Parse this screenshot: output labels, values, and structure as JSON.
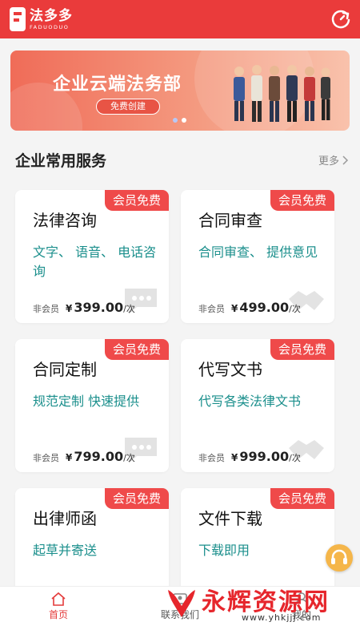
{
  "app": {
    "logo_cn": "法多多",
    "logo_en": "FADUODUO"
  },
  "banner": {
    "title": "企业云端法务部",
    "button": "免费创建",
    "slides": 2,
    "active_slide": 0
  },
  "section": {
    "title": "企业常用服务",
    "more": "更多"
  },
  "cards": [
    {
      "badge": "会员免费",
      "title": "法律咨询",
      "desc": "文字、 语音、 电话咨询",
      "nonmember": "非会员",
      "currency": "¥",
      "price": "399.00",
      "unit": "/次"
    },
    {
      "badge": "会员免费",
      "title": "合同审查",
      "desc": "合同审查、 提供意见",
      "nonmember": "非会员",
      "currency": "¥",
      "price": "499.00",
      "unit": "/次"
    },
    {
      "badge": "会员免费",
      "title": "合同定制",
      "desc": "规范定制 快速提供",
      "nonmember": "非会员",
      "currency": "¥",
      "price": "799.00",
      "unit": "/次"
    },
    {
      "badge": "会员免费",
      "title": "代写文书",
      "desc": "代写各类法律文书",
      "nonmember": "非会员",
      "currency": "¥",
      "price": "999.00",
      "unit": "/次"
    },
    {
      "badge": "会员免费",
      "title": "出律师函",
      "desc": "起草并寄送"
    },
    {
      "badge": "会员免费",
      "title": "文件下载",
      "desc": "下载即用"
    }
  ],
  "bottom_nav": [
    {
      "label": "首页",
      "icon": "home-icon",
      "active": true
    },
    {
      "label": "联系我们",
      "icon": "contact-icon",
      "active": false
    },
    {
      "label": "我的",
      "icon": "user-icon",
      "active": false
    }
  ],
  "watermark": {
    "text": "永辉资源网",
    "url": "www.yhkjjj.com"
  },
  "colors": {
    "brand_red": "#ea3b3b",
    "badge_red": "#ef4a4a",
    "teal_text": "#1b8f8c",
    "headset": "#f5b64a"
  }
}
